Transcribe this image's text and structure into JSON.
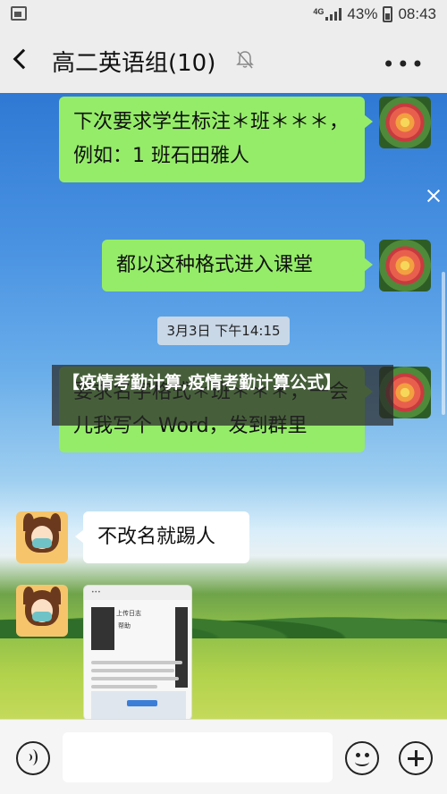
{
  "status_bar": {
    "network": "4G",
    "battery": "43%",
    "time": "08:43"
  },
  "header": {
    "title": "高二英语组(10)",
    "back_icon": "back-arrow-icon",
    "mute_icon": "bell-off-icon",
    "more_label": "•••"
  },
  "messages": [
    {
      "sender": "me",
      "text": "下次要求学生标注＊班＊＊＊，例如：1 班石田雅人"
    },
    {
      "sender": "me",
      "text": "都以这种格式进入课堂"
    },
    {
      "type": "timestamp",
      "text": "3月3日 下午14:15"
    },
    {
      "sender": "me",
      "text": "要求名字格式＊班＊＊＊，一会儿我写个 Word，发到群里"
    },
    {
      "sender": "other",
      "text": "不改名就踢人"
    },
    {
      "sender": "other",
      "type": "image",
      "doc": {
        "header": "•••",
        "title": "上传日志",
        "subtitle": "帮助"
      }
    }
  ],
  "overlay": {
    "text": "【疫情考勤计算,疫情考勤计算公式】"
  },
  "input_bar": {
    "voice_icon": "voice-icon",
    "emoji_icon": "emoji-icon",
    "plus_icon": "plus-icon"
  }
}
